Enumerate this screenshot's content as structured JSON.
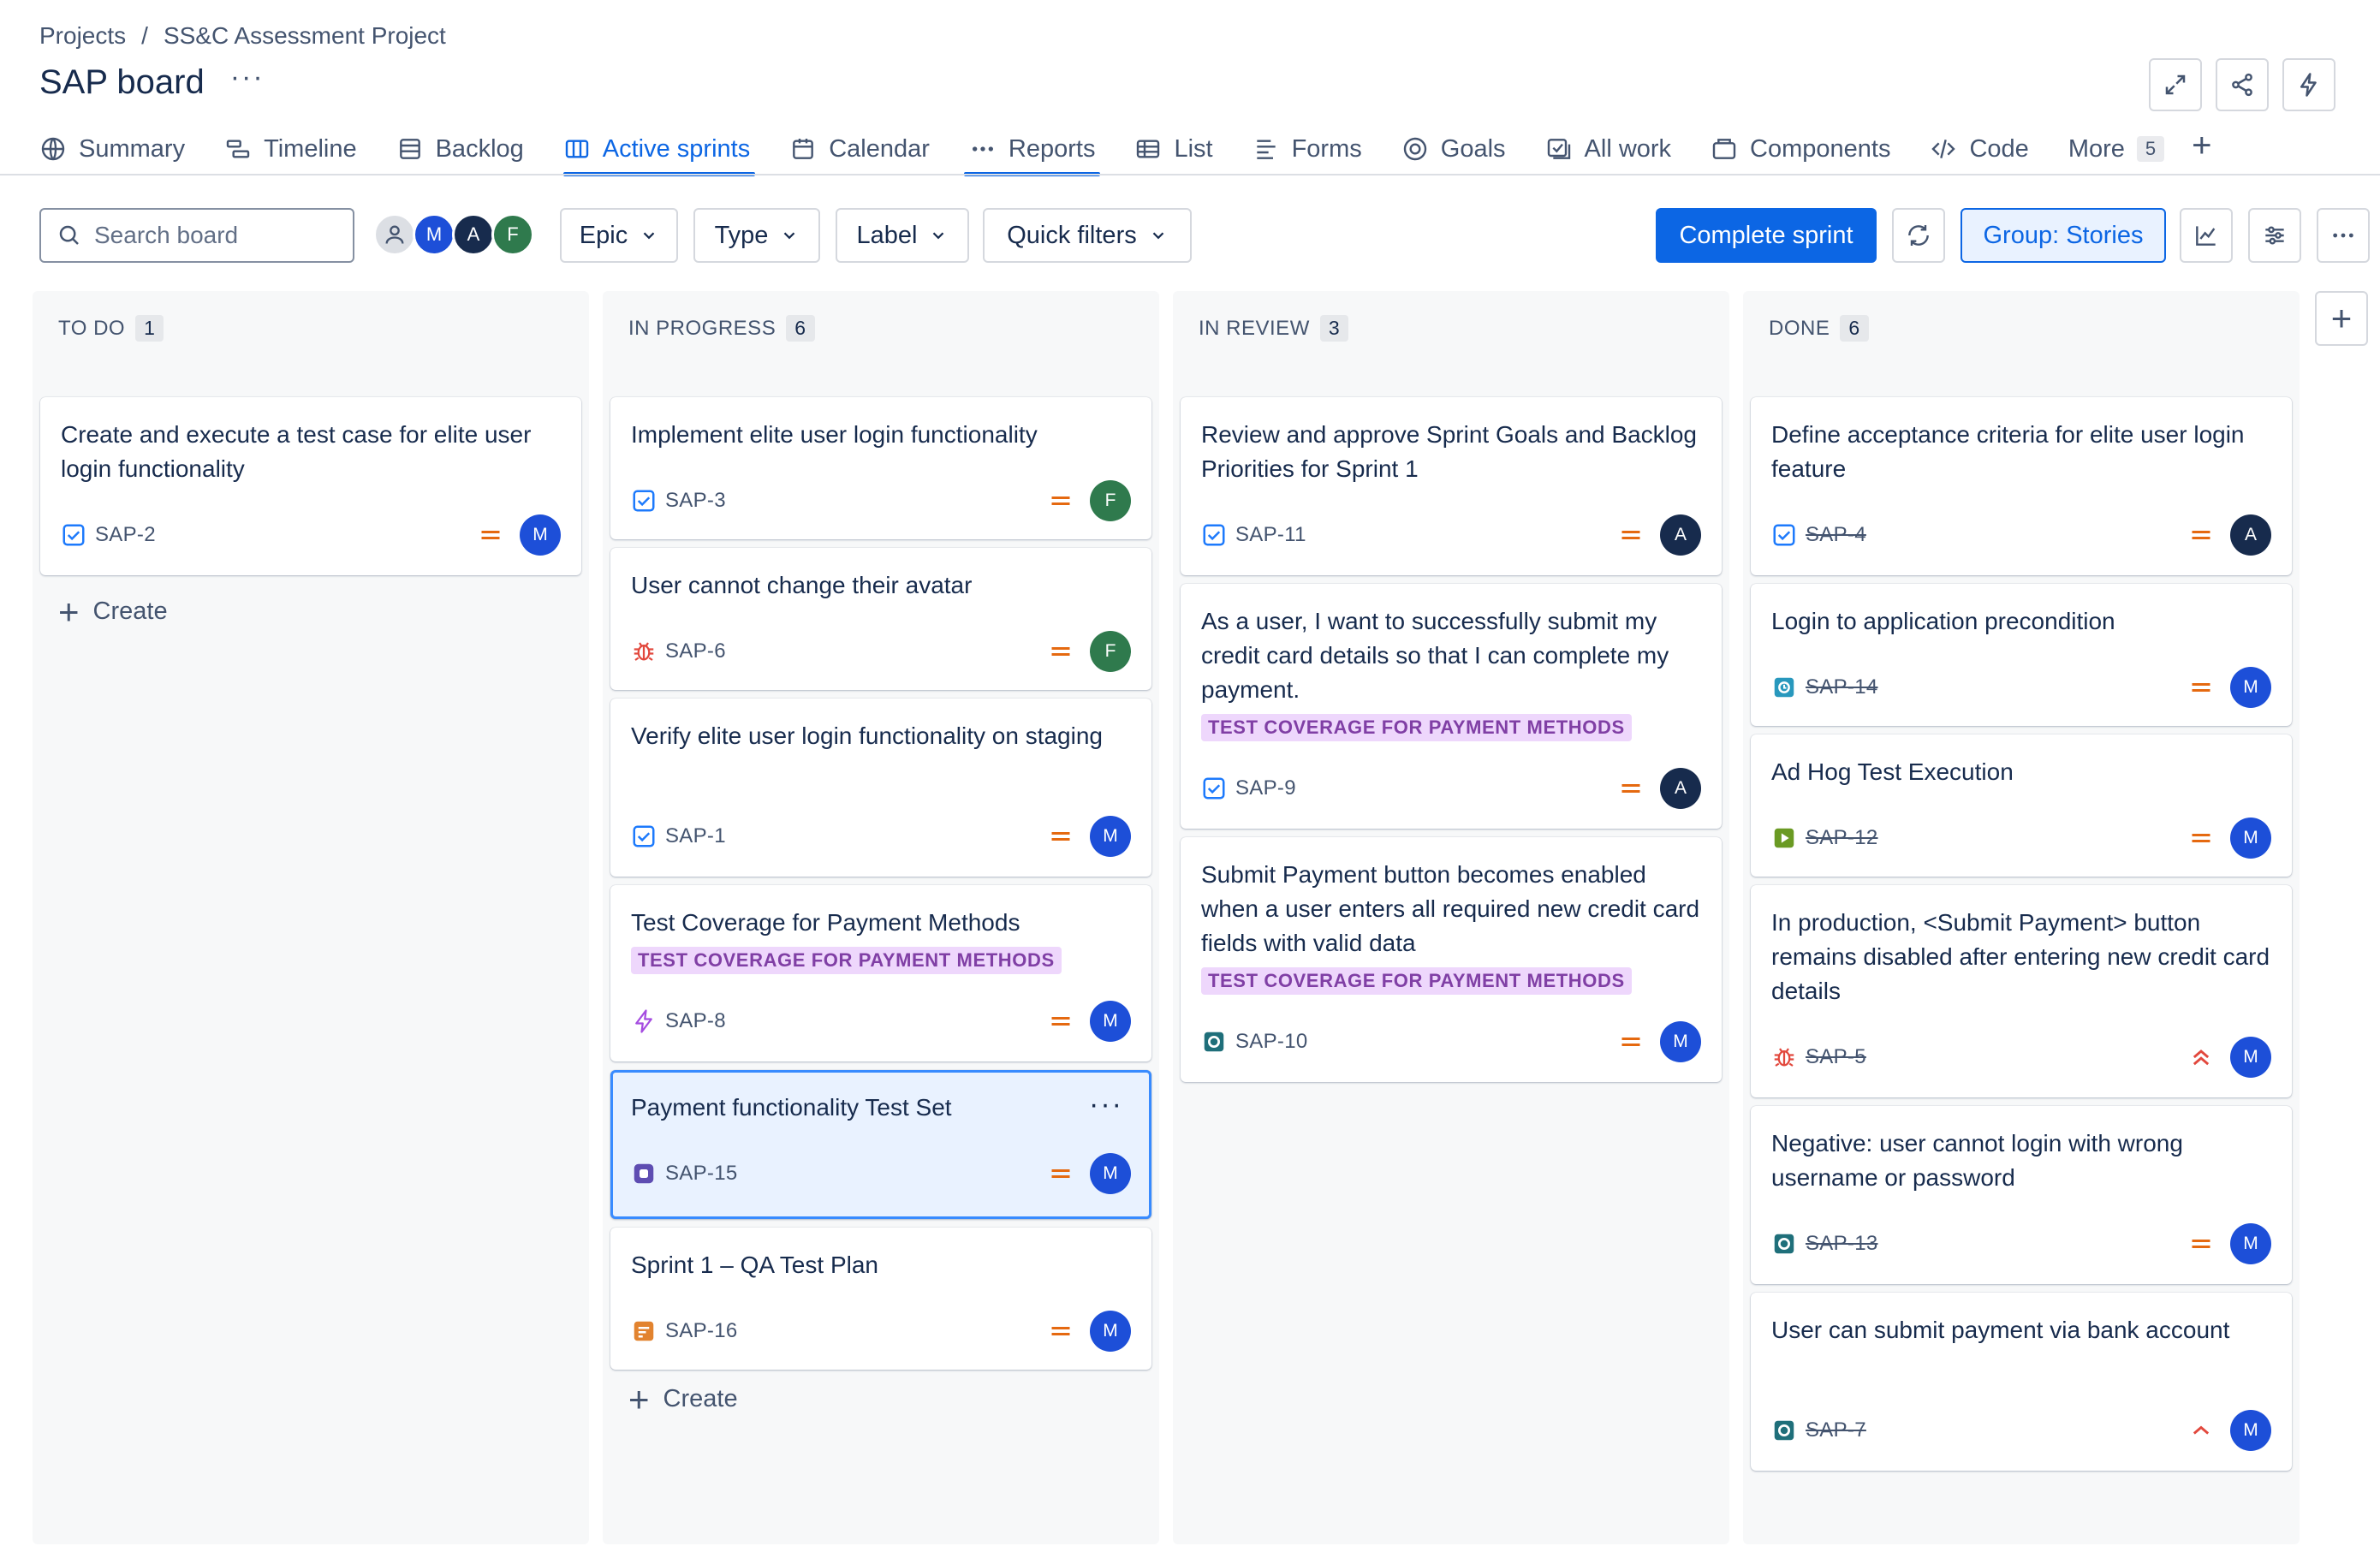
{
  "breadcrumb": {
    "projects": "Projects",
    "separator": "/",
    "project": "SS&C Assessment Project"
  },
  "page": {
    "title": "SAP board",
    "more": "···"
  },
  "tabs": [
    {
      "label": "Summary",
      "icon": "globe-icon"
    },
    {
      "label": "Timeline",
      "icon": "timeline-icon"
    },
    {
      "label": "Backlog",
      "icon": "backlog-icon"
    },
    {
      "label": "Active sprints",
      "icon": "board-icon",
      "active": true
    },
    {
      "label": "Calendar",
      "icon": "calendar-icon"
    },
    {
      "label": "Reports",
      "icon": "dots-icon"
    },
    {
      "label": "List",
      "icon": "list-icon"
    },
    {
      "label": "Forms",
      "icon": "forms-icon"
    },
    {
      "label": "Goals",
      "icon": "goals-icon"
    },
    {
      "label": "All work",
      "icon": "all-work-icon"
    },
    {
      "label": "Components",
      "icon": "components-icon"
    },
    {
      "label": "Code",
      "icon": "code-icon"
    },
    {
      "label": "More",
      "count": "5"
    }
  ],
  "toolbar": {
    "search_placeholder": "Search board",
    "avatars": [
      "M",
      "A",
      "F"
    ],
    "filters": [
      "Epic",
      "Type",
      "Label",
      "Quick filters"
    ],
    "complete_sprint": "Complete sprint",
    "group_by": "Group: Stories"
  },
  "columns": [
    {
      "name": "TO DO",
      "count": "1",
      "create": "Create",
      "cards": [
        {
          "title": "Create and execute a test case for elite user login functionality",
          "type": "task",
          "key": "SAP-2",
          "priority": "medium",
          "assignee": "M",
          "done": false
        }
      ]
    },
    {
      "name": "IN PROGRESS",
      "count": "6",
      "create": "Create",
      "cards": [
        {
          "title": "Implement elite user login functionality",
          "type": "task",
          "key": "SAP-3",
          "priority": "medium",
          "assignee": "F",
          "done": false
        },
        {
          "title": "User cannot change their avatar",
          "type": "bug",
          "key": "SAP-6",
          "priority": "medium",
          "assignee": "F",
          "done": false
        },
        {
          "title": "Verify elite user login functionality on staging",
          "type": "task",
          "key": "SAP-1",
          "priority": "medium",
          "assignee": "M",
          "done": false
        },
        {
          "title": "Test Coverage for Payment Methods",
          "label": "TEST COVERAGE FOR PAYMENT METHODS",
          "type": "epic",
          "key": "SAP-8",
          "priority": "medium",
          "assignee": "M",
          "done": false
        },
        {
          "title": "Payment functionality Test Set",
          "type": "test-set",
          "key": "SAP-15",
          "priority": "medium",
          "assignee": "M",
          "done": false,
          "selected": true
        },
        {
          "title": "Sprint 1 – QA Test Plan",
          "type": "test-plan",
          "key": "SAP-16",
          "priority": "medium",
          "assignee": "M",
          "done": false
        }
      ]
    },
    {
      "name": "IN REVIEW",
      "count": "3",
      "cards": [
        {
          "title": "Review and approve Sprint Goals and Backlog Priorities for Sprint 1",
          "type": "task",
          "key": "SAP-11",
          "priority": "medium",
          "assignee": "A",
          "done": false
        },
        {
          "title": "As a user, I want to successfully submit my credit card details so that I can complete my payment.",
          "label": "TEST COVERAGE FOR PAYMENT METHODS",
          "type": "task",
          "key": "SAP-9",
          "priority": "medium",
          "assignee": "A",
          "done": false
        },
        {
          "title": "Submit Payment button becomes enabled when a user enters all required new credit card fields with valid data",
          "label": "TEST COVERAGE FOR PAYMENT METHODS",
          "type": "test",
          "key": "SAP-10",
          "priority": "medium",
          "assignee": "M",
          "done": false
        }
      ]
    },
    {
      "name": "DONE",
      "count": "6",
      "cards": [
        {
          "title": "Define acceptance criteria for elite user login feature",
          "type": "task",
          "key": "SAP-4",
          "priority": "medium",
          "assignee": "A",
          "done": true
        },
        {
          "title": "Login to application precondition",
          "type": "precondition",
          "key": "SAP-14",
          "priority": "medium",
          "assignee": "M",
          "done": true
        },
        {
          "title": "Ad Hog Test Execution",
          "type": "test-execution",
          "key": "SAP-12",
          "priority": "medium",
          "assignee": "M",
          "done": true
        },
        {
          "title": "In production, <Submit Payment> button remains disabled after entering new credit card details",
          "type": "bug",
          "key": "SAP-5",
          "priority": "highest",
          "assignee": "M",
          "done": true
        },
        {
          "title": "Negative: user cannot login with wrong username or password",
          "type": "test",
          "key": "SAP-13",
          "priority": "medium",
          "assignee": "M",
          "done": true
        },
        {
          "title": "User can submit payment via bank account",
          "type": "test",
          "key": "SAP-7",
          "priority": "high",
          "assignee": "M",
          "done": true
        }
      ]
    }
  ],
  "colors": {
    "accent": "#0c66e4",
    "priority_medium": "#e56910",
    "priority_high": "#e2483d",
    "lozenge_bg": "#eed7fc",
    "lozenge_fg": "#803fa5"
  }
}
